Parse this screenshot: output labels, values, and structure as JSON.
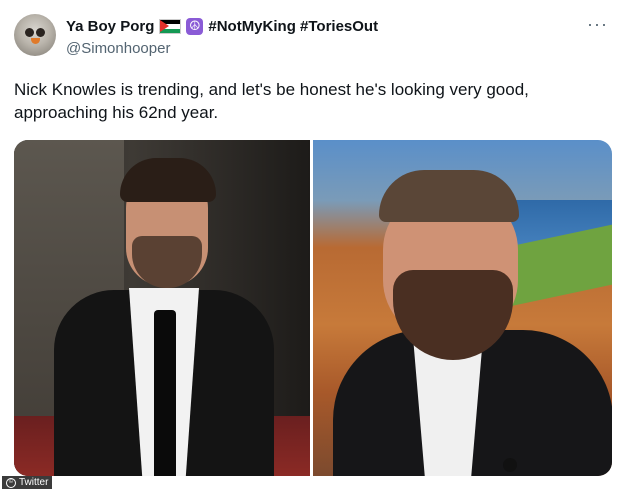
{
  "author": {
    "display_name": "Ya Boy Porg",
    "hashtags": "#NotMyKing #ToriesOut",
    "handle": "@Simonhooper",
    "avatar_icon": "porg-avatar-icon",
    "flag_icon": "palestine-flag-icon",
    "emoji_icon": "peace-symbol-icon"
  },
  "menu": {
    "more_label": "···"
  },
  "tweet": {
    "text": "Nick Knowles is trending, and let's be honest he's looking very good, approaching his 62nd year."
  },
  "media": {
    "count": 2,
    "watermark": "Twitter"
  },
  "colors": {
    "text_primary": "#0f1419",
    "text_secondary": "#536471",
    "emoji_bg": "#8a5bd6"
  }
}
